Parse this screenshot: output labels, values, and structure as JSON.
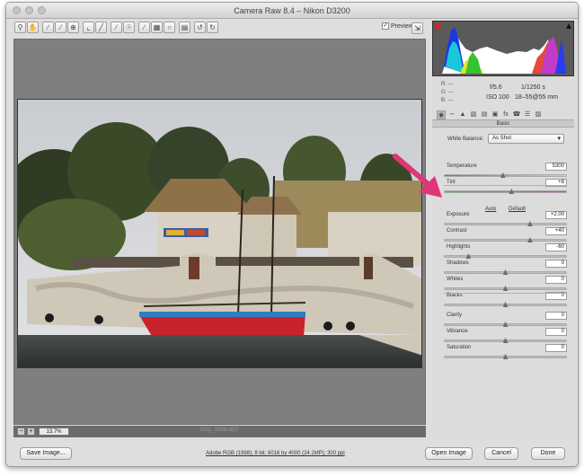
{
  "window": {
    "title": "Camera Raw 8.4  –  Nikon D3200"
  },
  "toolbar": {
    "tools": [
      "zoom-icon",
      "hand-icon",
      "white-balance-icon",
      "color-sampler-icon",
      "targeted-adjustment-icon",
      "crop-icon",
      "straighten-icon",
      "spot-removal-icon",
      "red-eye-icon",
      "adjustment-brush-icon",
      "graduated-filter-icon",
      "radial-filter-icon",
      "preferences-icon",
      "rotate-left-icon",
      "rotate-right-icon"
    ],
    "preview_label": "Preview",
    "preview_checked": true
  },
  "preview": {
    "filename": "DSC_0006.NEF",
    "zoom": "13.7%"
  },
  "histogram": {
    "rgb_labels": [
      "R:",
      "G:",
      "B:"
    ],
    "rgb_values": [
      "---",
      "---",
      "---"
    ],
    "aperture": "f/5.6",
    "shutter": "1/1250 s",
    "iso": "ISO 100",
    "lens": "18–55@55 mm"
  },
  "panel": {
    "title": "Basic",
    "tab_icons": [
      "basic-icon",
      "tone-curve-icon",
      "detail-icon",
      "hsl-icon",
      "split-toning-icon",
      "lens-corrections-icon",
      "effects-icon",
      "camera-calibration-icon",
      "presets-icon",
      "snapshots-icon"
    ],
    "white_balance_label": "White Balance:",
    "white_balance_value": "As Shot",
    "auto_label": "Auto",
    "default_label": "Default",
    "sliders": [
      {
        "label": "Temperature",
        "value": "5300",
        "position": 0.48,
        "style": "temp"
      },
      {
        "label": "Tint",
        "value": "+8",
        "position": 0.55,
        "style": "tint"
      },
      {
        "label": "Exposure",
        "value": "+2.00",
        "position": 0.7,
        "style": "plain"
      },
      {
        "label": "Contrast",
        "value": "+40",
        "position": 0.7,
        "style": "plain"
      },
      {
        "label": "Highlights",
        "value": "-60",
        "position": 0.2,
        "style": "plain"
      },
      {
        "label": "Shadows",
        "value": "0",
        "position": 0.5,
        "style": "plain"
      },
      {
        "label": "Whites",
        "value": "0",
        "position": 0.5,
        "style": "plain"
      },
      {
        "label": "Blacks",
        "value": "0",
        "position": 0.5,
        "style": "plain"
      },
      {
        "label": "Clarity",
        "value": "0",
        "position": 0.5,
        "style": "plain"
      },
      {
        "label": "Vibrance",
        "value": "0",
        "position": 0.5,
        "style": "plain"
      },
      {
        "label": "Saturation",
        "value": "0",
        "position": 0.5,
        "style": "plain"
      }
    ]
  },
  "footer": {
    "save_label": "Save Image...",
    "workflow_link": "Adobe RGB (1998); 8 bit; 6016 by 4000 (24.1MP); 300 ppi",
    "open_label": "Open Image",
    "cancel_label": "Cancel",
    "done_label": "Done"
  },
  "colors": {
    "annotation_arrow": "#e0357b",
    "window_bg": "#dedede",
    "preview_bg": "#7f7f7f"
  }
}
